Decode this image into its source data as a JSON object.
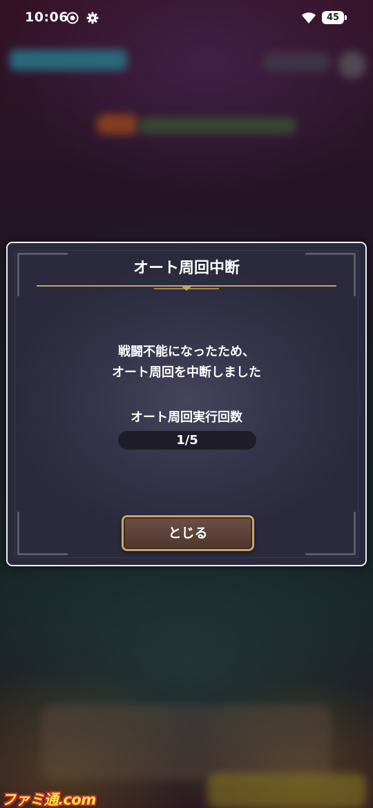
{
  "status_bar": {
    "time": "10:06",
    "battery": "45",
    "icons": [
      "screen-record-icon",
      "gear-icon",
      "wifi-icon",
      "battery-icon"
    ]
  },
  "dialog": {
    "title": "オート周回中断",
    "message_lines": [
      "戦闘不能になったため、",
      "オート周回を中断しました"
    ],
    "count_label": "オート周回実行回数",
    "count_value": "1/5",
    "close_label": "とじる"
  },
  "watermark": {
    "text": "ファミ通.com"
  },
  "colors": {
    "dialog_background": "#34334a",
    "dialog_border": "#f2f0f5",
    "gold_accent": "#c9a46a",
    "button_fill": "#5a4036",
    "pill_background": "#1e1d29"
  }
}
